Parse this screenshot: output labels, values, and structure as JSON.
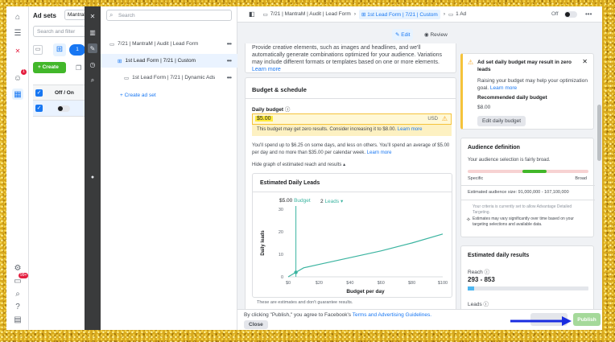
{
  "rail": {
    "icons": [
      "home-icon",
      "menu-icon",
      "adobe-icon",
      "avatar-icon",
      "grid-icon",
      "settings-icon",
      "notifications-icon",
      "search-icon",
      "help-icon",
      "report-icon"
    ],
    "notif_badge": "1",
    "bottom_badge": "99+"
  },
  "adsets": {
    "title": "Ad sets",
    "dropdown_value": "MantraM",
    "search_placeholder": "Search and filter",
    "create_label": "+ Create",
    "column_header": "Off / On",
    "count_badge": "1"
  },
  "tree": {
    "search_placeholder": "Search",
    "campaign": "7/21 | MantraM | Audit | Lead Form",
    "adset": "1st Lead Form | 7/21 | Custom",
    "ad": "1st Lead Form | 7/21 | Dynamic Ads",
    "create_link": "+ Create ad set"
  },
  "topbar": {
    "crumb_campaign": "7/21 | MantraM | Audit | Lead Form",
    "crumb_adset": "1st Lead Form | 7/21 | Custom",
    "crumb_ad": "1 Ad",
    "toggle_label": "Off"
  },
  "tabs": {
    "edit": "Edit",
    "review": "Review"
  },
  "creative": {
    "text": "Provide creative elements, such as images and headlines, and we'll automatically generate combinations optimized for your audience. Variations may include different formats or templates based on one or more elements.",
    "learn_more": "Learn more"
  },
  "budget": {
    "section_title": "Budget & schedule",
    "daily_label": "Daily budget",
    "value": "$5.00",
    "currency": "USD",
    "warning": "This budget may get zero results. Consider increasing it to $8.00.",
    "warning_link": "Learn more",
    "spend_note": "You'll spend up to $6.25 on some days, and less on others. You'll spend an average of $5.00 per day and no more than $35.00 per calendar week.",
    "spend_link": "Learn more",
    "hide_graph": "Hide graph of estimated reach and results"
  },
  "chart_data": {
    "type": "line",
    "title": "Estimated Daily Leads",
    "selector_budget_value": "$5.00",
    "selector_budget_label": "Budget",
    "selector_leads_value": "2",
    "selector_leads_label": "Leads",
    "xlabel": "Budget per day",
    "ylabel": "Daily leads",
    "x_ticks": [
      "$0",
      "$20",
      "$40",
      "$60",
      "$80",
      "$100"
    ],
    "y_ticks": [
      "0",
      "10",
      "20",
      "30"
    ],
    "xlim": [
      0,
      100
    ],
    "ylim": [
      0,
      30
    ],
    "x": [
      0,
      5,
      10,
      20,
      40,
      60,
      80,
      100
    ],
    "y": [
      0,
      2,
      4,
      5.5,
      8.5,
      11.5,
      15,
      19
    ],
    "marker": {
      "x": 5,
      "y": 2
    },
    "footnote": "These are estimates and don't guarantee results."
  },
  "right": {
    "alert_title": "Ad set daily budget may result in zero leads",
    "alert_body": "Raising your budget may help your optimization goal.",
    "alert_link": "Learn more",
    "recommended_label": "Recommended daily budget",
    "recommended_value": "$8.00",
    "edit_button": "Edit daily budget",
    "aud_title": "Audience definition",
    "aud_status": "Your audience selection is fairly broad.",
    "aud_specific": "Specific",
    "aud_broad": "Broad",
    "aud_level": 0.55,
    "aud_size": "Estimated audience size: 91,000,000 - 107,100,000",
    "aud_note1": "Your criteria is currently set to allow Advantage Detailed Targeting.",
    "aud_note2": "Estimates may vary significantly over time based on your targeting selections and available data.",
    "results_title": "Estimated daily results",
    "reach_label": "Reach",
    "reach_value": "293 - 853",
    "reach_level": 0.05,
    "leads_label": "Leads"
  },
  "footer": {
    "terms_text": "By clicking \"Publish,\" you agree to Facebook's",
    "terms_link": "Terms and Advertising Guidelines.",
    "close": "Close",
    "publish": "Publish"
  }
}
